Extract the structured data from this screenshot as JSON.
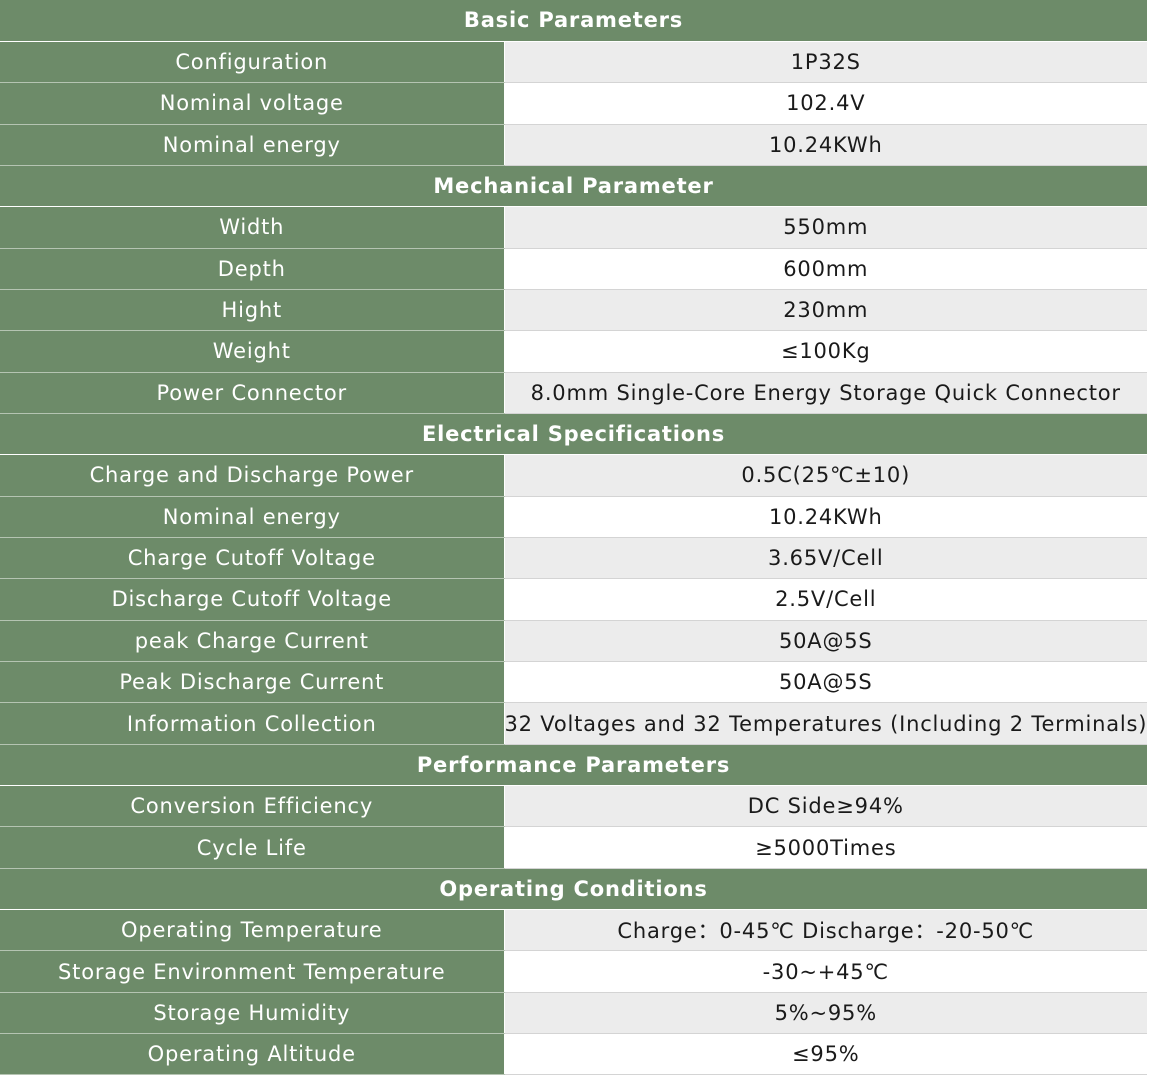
{
  "colors": {
    "section_background": "#6d8b69",
    "label_background": "#6d8b69",
    "label_text": "#ffffff",
    "value_background_alt": "#ececec",
    "value_background": "#ffffff",
    "value_text": "#1a1a1a"
  },
  "sections": [
    {
      "title": "Basic Parameters",
      "rows": [
        {
          "label": "Configuration",
          "value": "1P32S"
        },
        {
          "label": "Nominal voltage",
          "value": "102.4V"
        },
        {
          "label": "Nominal energy",
          "value": "10.24KWh"
        }
      ]
    },
    {
      "title": "Mechanical Parameter",
      "rows": [
        {
          "label": "Width",
          "value": "550mm"
        },
        {
          "label": "Depth",
          "value": "600mm"
        },
        {
          "label": "Hight",
          "value": "230mm"
        },
        {
          "label": "Weight",
          "value": "≤100Kg"
        },
        {
          "label": "Power Connector",
          "value": "8.0mm Single-Core Energy Storage Quick Connector"
        }
      ]
    },
    {
      "title": "Electrical Specifications",
      "rows": [
        {
          "label": "Charge and Discharge Power",
          "value": "0.5C(25℃±10)"
        },
        {
          "label": "Nominal energy",
          "value": "10.24KWh"
        },
        {
          "label": "Charge Cutoff Voltage",
          "value": "3.65V/Cell"
        },
        {
          "label": "Discharge Cutoff Voltage",
          "value": "2.5V/Cell"
        },
        {
          "label": "peak Charge Current",
          "value": "50A@5S"
        },
        {
          "label": "Peak Discharge Current",
          "value": "50A@5S"
        },
        {
          "label": "Information Collection",
          "value": "32 Voltages and 32 Temperatures (Including 2 Terminals)"
        }
      ]
    },
    {
      "title": "Performance Parameters",
      "rows": [
        {
          "label": "Conversion Efficiency",
          "value": "DC Side≥94%"
        },
        {
          "label": "Cycle Life",
          "value": "≥5000Times"
        }
      ]
    },
    {
      "title": "Operating Conditions",
      "rows": [
        {
          "label": "Operating Temperature",
          "value": "Charge：0-45℃ Discharge：-20-50℃"
        },
        {
          "label": "Storage Environment Temperature",
          "value": "-30~+45℃"
        },
        {
          "label": "Storage Humidity",
          "value": "5%~95%"
        },
        {
          "label": "Operating Altitude",
          "value": "≤95%"
        }
      ]
    }
  ]
}
